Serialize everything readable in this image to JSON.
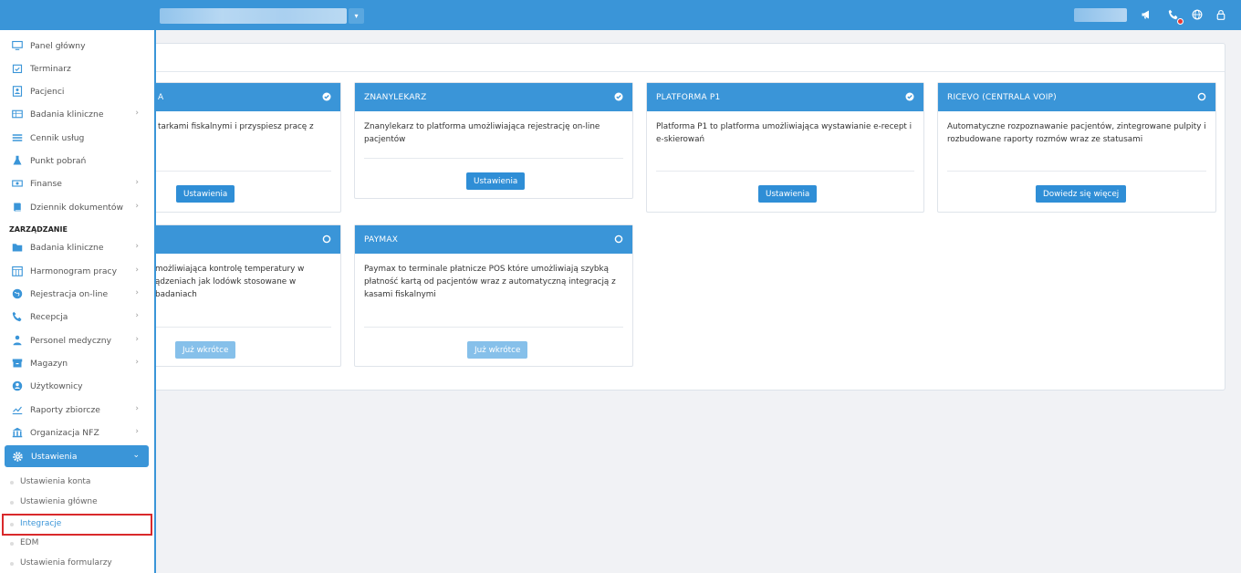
{
  "header": {
    "clinic_dropdown_icon": "chevron-down-icon",
    "icons": [
      "megaphone-icon",
      "phone-icon",
      "globe-icon",
      "lock-icon"
    ]
  },
  "sidebar": {
    "items": [
      {
        "label": "Panel główny",
        "icon": "monitor-icon",
        "arrow": false
      },
      {
        "label": "Terminarz",
        "icon": "calendar-check-icon",
        "arrow": false
      },
      {
        "label": "Pacjenci",
        "icon": "person-card-icon",
        "arrow": false
      },
      {
        "label": "Badania kliniczne",
        "icon": "table-icon",
        "arrow": true
      },
      {
        "label": "Cennik usług",
        "icon": "list-icon",
        "arrow": false
      },
      {
        "label": "Punkt pobrań",
        "icon": "flask-icon",
        "arrow": false
      },
      {
        "label": "Finanse",
        "icon": "money-icon",
        "arrow": true
      },
      {
        "label": "Dziennik dokumentów",
        "icon": "book-icon",
        "arrow": true
      }
    ],
    "section_label": "ZARZĄDZANIE",
    "manage_items": [
      {
        "label": "Badania kliniczne",
        "icon": "folder-icon",
        "arrow": true
      },
      {
        "label": "Harmonogram pracy",
        "icon": "calendar-grid-icon",
        "arrow": true
      },
      {
        "label": "Rejestracja on-line",
        "icon": "globe-icon",
        "arrow": true
      },
      {
        "label": "Recepcja",
        "icon": "phone-icon",
        "arrow": true
      },
      {
        "label": "Personel medyczny",
        "icon": "doctor-icon",
        "arrow": true
      },
      {
        "label": "Magazyn",
        "icon": "box-icon",
        "arrow": true
      },
      {
        "label": "Użytkownicy",
        "icon": "user-circle-icon",
        "arrow": false
      },
      {
        "label": "Raporty zbiorcze",
        "icon": "chart-icon",
        "arrow": true
      },
      {
        "label": "Organizacja NFZ",
        "icon": "bank-icon",
        "arrow": true
      }
    ],
    "active": {
      "label": "Ustawienia",
      "icon": "gear-icon"
    },
    "subitems": [
      "Ustawienia konta",
      "Ustawienia główne",
      "Integracje",
      "EDM",
      "Ustawienia formularzy"
    ]
  },
  "cards": [
    {
      "title": "A",
      "text": "tarkami fiskalnymi i przyspiesz pracę z",
      "button": "Ustawienia",
      "status": "active"
    },
    {
      "title": "ZNANYLEKARZ",
      "text": "Znanylekarz to platforma umożliwiająca rejestrację on-line pacjentów",
      "button": "Ustawienia",
      "status": "active"
    },
    {
      "title": "PLATFORMA P1",
      "text": "Platforma P1 to platforma umożliwiająca wystawianie e-recept i e-skierowań",
      "button": "Ustawienia",
      "status": "active"
    },
    {
      "title": "RICEVO (CENTRALA VOIP)",
      "text": "Automatyczne rozpoznawanie pacjentów, zintegrowane pulpity i rozbudowane raporty rozmów wraz ze statusami",
      "button": "Dowiedz się więcej",
      "status": "inactive"
    },
    {
      "title": "",
      "text": "możliwiająca kontrolę temperatury w ądzeniach jak lodówk stosowane w badaniach",
      "button": "Już wkrótce",
      "status": "inactive"
    },
    {
      "title": "PAYMAX",
      "text": "Paymax to terminale płatnicze POS które umożliwiają szybką płatność kartą od pacjentów wraz z automatyczną integracją z kasami fiskalnymi",
      "button": "Już wkrótce",
      "status": "inactive"
    }
  ]
}
